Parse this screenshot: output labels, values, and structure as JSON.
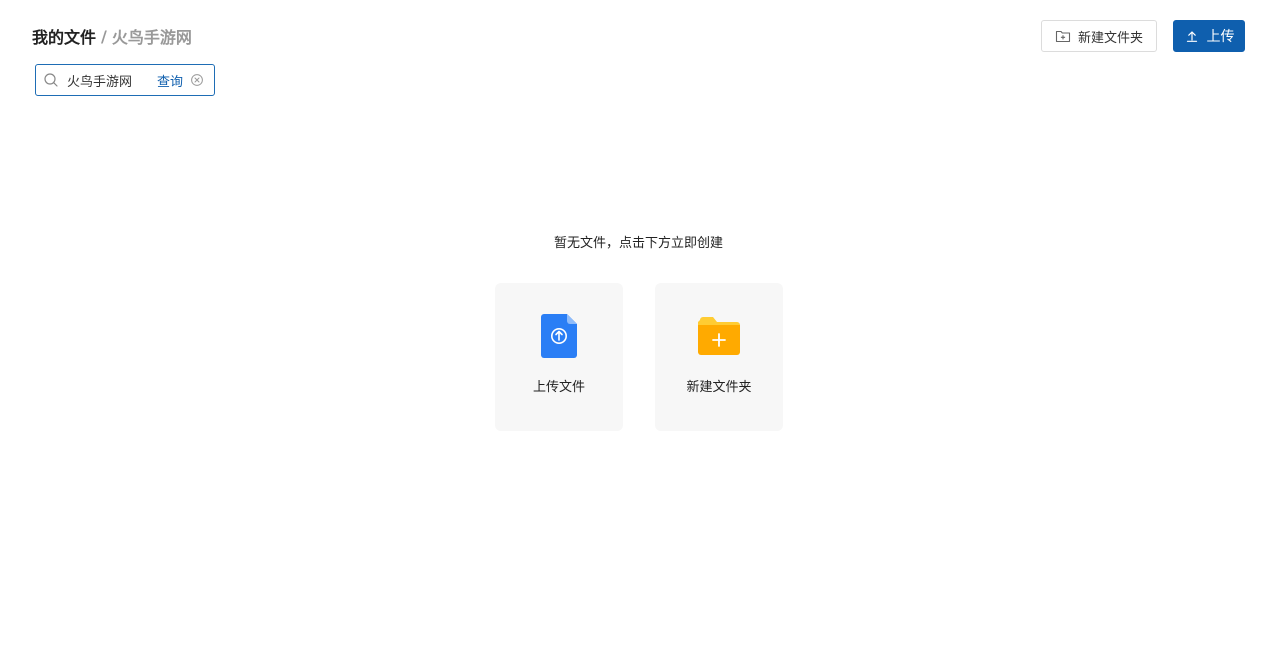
{
  "breadcrumb": {
    "root": "我的文件",
    "separator": "/",
    "current": "火鸟手游网"
  },
  "toolbar": {
    "new_folder_label": "新建文件夹",
    "new_folder_icon": "folder-plus-icon",
    "upload_label": "上传",
    "upload_icon": "upload-icon"
  },
  "search": {
    "value": "火鸟手游网",
    "placeholder": "",
    "query_label": "查询",
    "search_icon": "search-icon",
    "clear_icon": "clear-circle-icon"
  },
  "empty_state": {
    "message": "暂无文件，点击下方立即创建",
    "cards": [
      {
        "label": "上传文件",
        "icon": "upload-file-icon"
      },
      {
        "label": "新建文件夹",
        "icon": "new-folder-icon"
      }
    ]
  },
  "colors": {
    "primary": "#0f5fae",
    "file_blue": "#2a7ef5",
    "folder_orange": "#ffaa00",
    "card_bg": "#f7f7f7",
    "muted_text": "#999999"
  }
}
